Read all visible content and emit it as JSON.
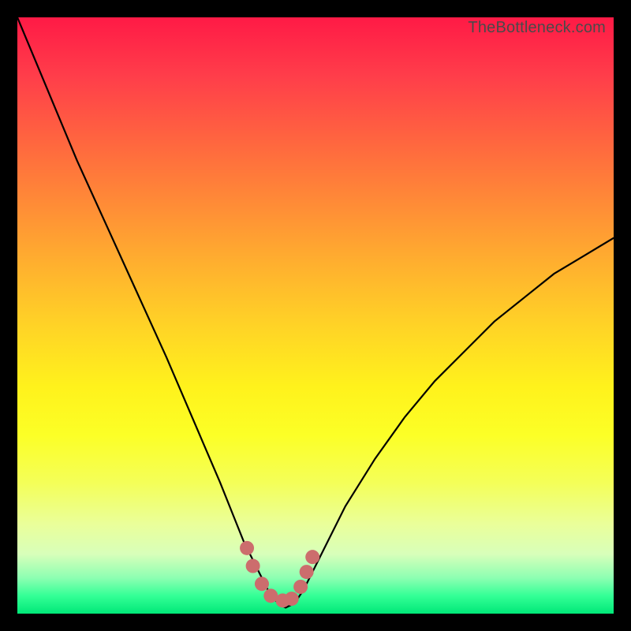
{
  "watermark": "TheBottleneck.com",
  "chart_data": {
    "type": "line",
    "title": "",
    "xlabel": "",
    "ylabel": "",
    "xlim": [
      0,
      100
    ],
    "ylim": [
      0,
      100
    ],
    "series": [
      {
        "name": "bottleneck-curve",
        "x": [
          0,
          5,
          10,
          15,
          20,
          25,
          28,
          31,
          34,
          36,
          38,
          40,
          41,
          42,
          43,
          44,
          45,
          46,
          47,
          48,
          50,
          52,
          55,
          60,
          65,
          70,
          75,
          80,
          85,
          90,
          95,
          100
        ],
        "y": [
          100,
          88,
          76,
          65,
          54,
          43,
          36,
          29,
          22,
          17,
          12,
          8,
          6,
          4,
          2.5,
          1.5,
          1,
          1.5,
          2.5,
          4,
          8,
          12,
          18,
          26,
          33,
          39,
          44,
          49,
          53,
          57,
          60,
          63
        ]
      }
    ],
    "markers": {
      "name": "bottom-markers",
      "color": "#cc6d6d",
      "points": [
        {
          "x": 38.5,
          "y": 11
        },
        {
          "x": 39.5,
          "y": 8
        },
        {
          "x": 41,
          "y": 5
        },
        {
          "x": 42.5,
          "y": 3
        },
        {
          "x": 44.5,
          "y": 2.2
        },
        {
          "x": 46,
          "y": 2.5
        },
        {
          "x": 47.5,
          "y": 4.5
        },
        {
          "x": 48.5,
          "y": 7
        },
        {
          "x": 49.5,
          "y": 9.5
        }
      ]
    },
    "gradient_stops": [
      {
        "pos": 0,
        "color": "#ff1a46"
      },
      {
        "pos": 50,
        "color": "#ffe020"
      },
      {
        "pos": 100,
        "color": "#00e878"
      }
    ]
  }
}
